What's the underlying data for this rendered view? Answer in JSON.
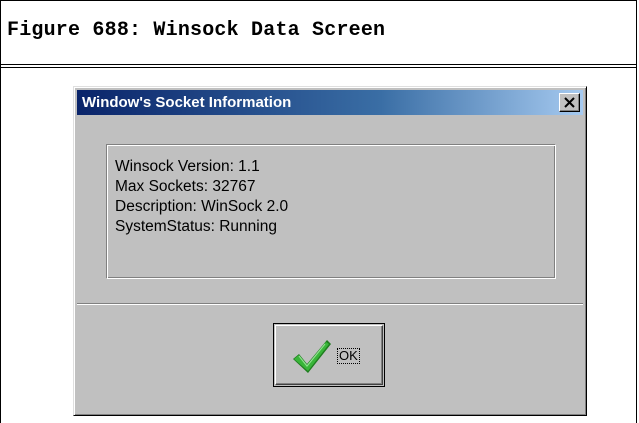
{
  "figure": {
    "title": "Figure 688: Winsock Data Screen"
  },
  "dialog": {
    "title": "Window's Socket Information",
    "close_icon": "close-x-icon",
    "info_lines": [
      "Winsock Version: 1.1",
      "Max Sockets: 32767",
      "Description: WinSock 2.0",
      "SystemStatus: Running"
    ],
    "ok_label": "OK",
    "ok_icon": "green-checkmark-icon"
  },
  "colors": {
    "titlebar_start": "#0a246a",
    "titlebar_end": "#a6caf0",
    "dialog_face": "#c0c0c0",
    "check_green": "#2e9e2e"
  }
}
